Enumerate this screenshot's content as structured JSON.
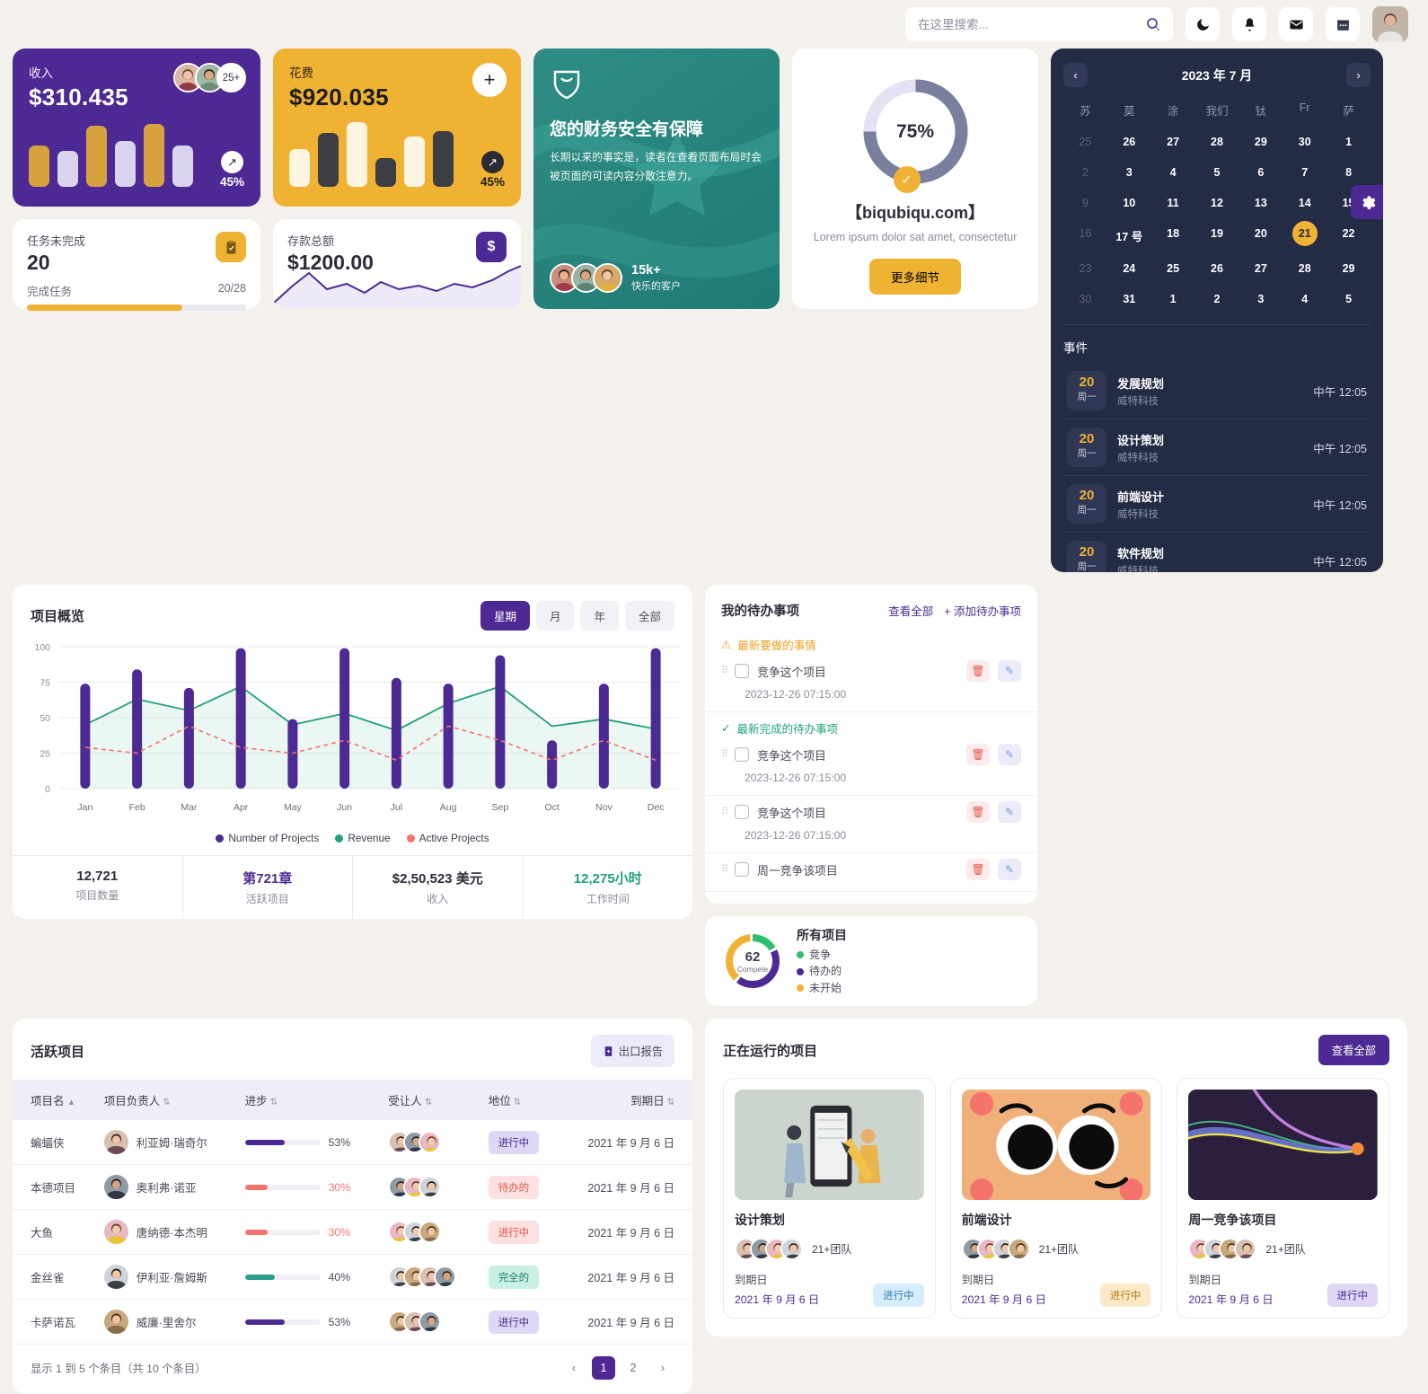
{
  "header": {
    "search_placeholder": "在这里搜索...",
    "icons": [
      "moon-icon",
      "bell-icon",
      "mail-icon",
      "calendar-icon"
    ]
  },
  "revenue_card": {
    "label": "收入",
    "value": "$310.435",
    "more_count": "25+",
    "trend_pct": "45%",
    "bars": [
      {
        "h": 46,
        "c": "#d8a33e"
      },
      {
        "h": 40,
        "c": "#d9d5ee"
      },
      {
        "h": 68,
        "c": "#d8a33e"
      },
      {
        "h": 51,
        "c": "#d9d5ee"
      },
      {
        "h": 70,
        "c": "#d8a33e"
      },
      {
        "h": 46,
        "c": "#d9d5ee"
      }
    ]
  },
  "expense_card": {
    "label": "花费",
    "value": "$920.035",
    "trend_pct": "45%",
    "bars": [
      {
        "h": 42,
        "c": "#fdf4e2"
      },
      {
        "h": 60,
        "c": "#3d3d44"
      },
      {
        "h": 72,
        "c": "#fdf4e2"
      },
      {
        "h": 32,
        "c": "#3d3d44"
      },
      {
        "h": 56,
        "c": "#fdf4e2"
      },
      {
        "h": 62,
        "c": "#3d3d44"
      }
    ]
  },
  "tasks_card": {
    "label": "任务未完成",
    "value": "20",
    "sub_label": "完成任务",
    "ratio": "20/28",
    "progress": 71
  },
  "deposit_card": {
    "label": "存款总额",
    "value": "$1200.00",
    "icon": "dollar-icon"
  },
  "promo_card": {
    "title": "您的财务安全有保障",
    "body": "长期以来的事实是，读者在查看页面布局时会被页面的可读内容分散注意力。",
    "customers_count": "15k+",
    "customers_label": "快乐的客户"
  },
  "donut_card": {
    "percent": "75%",
    "value": 75,
    "site": "【biqubiqu.com】",
    "subtitle": "Lorem ipsum dolor sat amet, consectetur",
    "button": "更多细节"
  },
  "calendar": {
    "month_title": "2023 年 7 月",
    "weekdays": [
      "苏",
      "莫",
      "涂",
      "我们",
      "钛",
      "Fr",
      "萨"
    ],
    "days": [
      {
        "d": "25",
        "mut": true
      },
      {
        "d": "26"
      },
      {
        "d": "27"
      },
      {
        "d": "28"
      },
      {
        "d": "29"
      },
      {
        "d": "30"
      },
      {
        "d": "1"
      },
      {
        "d": "2",
        "mut": true
      },
      {
        "d": "3"
      },
      {
        "d": "4"
      },
      {
        "d": "5"
      },
      {
        "d": "6"
      },
      {
        "d": "7"
      },
      {
        "d": "8"
      },
      {
        "d": "9",
        "mut": true
      },
      {
        "d": "10"
      },
      {
        "d": "11"
      },
      {
        "d": "12"
      },
      {
        "d": "13"
      },
      {
        "d": "14"
      },
      {
        "d": "15"
      },
      {
        "d": "16",
        "mut": true
      },
      {
        "d": "17 号"
      },
      {
        "d": "18"
      },
      {
        "d": "19"
      },
      {
        "d": "20"
      },
      {
        "d": "21",
        "sel": true
      },
      {
        "d": "22"
      },
      {
        "d": "23",
        "mut": true
      },
      {
        "d": "24"
      },
      {
        "d": "25"
      },
      {
        "d": "26"
      },
      {
        "d": "27"
      },
      {
        "d": "28"
      },
      {
        "d": "29"
      },
      {
        "d": "30",
        "mut": true
      },
      {
        "d": "31"
      },
      {
        "d": "1"
      },
      {
        "d": "2"
      },
      {
        "d": "3"
      },
      {
        "d": "4"
      },
      {
        "d": "5"
      }
    ],
    "events_title": "事件",
    "events": [
      {
        "day": "20",
        "weekday": "周一",
        "title": "发展规划",
        "company": "威特科技",
        "time": "中午 12:05"
      },
      {
        "day": "20",
        "weekday": "周一",
        "title": "设计策划",
        "company": "威特科技",
        "time": "中午 12:05"
      },
      {
        "day": "20",
        "weekday": "周一",
        "title": "前端设计",
        "company": "威特科技",
        "time": "中午 12:05"
      },
      {
        "day": "20",
        "weekday": "周一",
        "title": "软件规划",
        "company": "威特科技",
        "time": "中午 12:05"
      }
    ]
  },
  "overview": {
    "title": "项目概览",
    "filters": [
      {
        "label": "星期",
        "active": true
      },
      {
        "label": "月",
        "active": false
      },
      {
        "label": "年",
        "active": false
      },
      {
        "label": "全部",
        "active": false
      }
    ],
    "stats": [
      {
        "value": "12,721",
        "label": "项目数量",
        "color": "#2c2c3a"
      },
      {
        "value": "第721章",
        "label": "活跃项目",
        "color": "#4d2a93"
      },
      {
        "value": "$2,50,523 美元",
        "label": "收入",
        "color": "#2c2c3a"
      },
      {
        "value": "12,275小时",
        "label": "工作时间",
        "color": "#21a179"
      }
    ]
  },
  "chart_data": {
    "type": "bar",
    "title": "项目概览",
    "xlabel": "",
    "ylabel": "",
    "ylim": [
      0,
      100
    ],
    "yticks": [
      0,
      25,
      50,
      75,
      100
    ],
    "grid": true,
    "legend_position": "bottom",
    "categories": [
      "Jan",
      "Feb",
      "Mar",
      "Apr",
      "May",
      "Jun",
      "Jul",
      "Aug",
      "Sep",
      "Oct",
      "Nov",
      "Dec"
    ],
    "series": [
      {
        "name": "Number of Projects",
        "type": "bar",
        "color": "#4d2a93",
        "values": [
          74,
          84,
          71,
          99,
          49,
          99,
          78,
          74,
          94,
          34,
          74,
          99
        ]
      },
      {
        "name": "Revenue",
        "type": "area",
        "color": "#21a179",
        "values": [
          45,
          63,
          55,
          72,
          45,
          53,
          41,
          60,
          72,
          44,
          49,
          42
        ]
      },
      {
        "name": "Active Projects",
        "type": "line-dashed",
        "color": "#f4736d",
        "values": [
          29,
          25,
          44,
          29,
          25,
          34,
          20,
          44,
          34,
          20,
          34,
          20
        ]
      }
    ]
  },
  "todo": {
    "title": "我的待办事项",
    "see_all": "查看全部",
    "add": "+ 添加待办事项",
    "section_pending": "最新要做的事情",
    "section_done": "最新完成的待办事项",
    "items": [
      {
        "text": "竞争这个项目",
        "date": "2023-12-26 07:15:00",
        "section": "pending"
      },
      {
        "text": "竞争这个项目",
        "date": "2023-12-26 07:15:00",
        "section": "done"
      },
      {
        "text": "竞争这个项目",
        "date": "2023-12-26 07:15:00",
        "section": ""
      },
      {
        "text": "周一竞争该项目",
        "date": "",
        "section": ""
      }
    ]
  },
  "all_projects": {
    "center_value": "62",
    "center_label": "Compete",
    "title": "所有项目",
    "legend": [
      {
        "label": "竞争",
        "color": "#2fbf71"
      },
      {
        "label": "待办的",
        "color": "#4d2a93"
      },
      {
        "label": "未开始",
        "color": "#f0b232"
      }
    ],
    "segments": [
      {
        "label": "竞争",
        "value": 18,
        "color": "#2fbf71"
      },
      {
        "label": "待办的",
        "value": 44,
        "color": "#4d2a93"
      },
      {
        "label": "未开始",
        "value": 38,
        "color": "#f0b232"
      }
    ]
  },
  "table": {
    "title": "活跃项目",
    "export_label": "出口报告",
    "columns": [
      "项目名",
      "项目负责人",
      "进步",
      "受让人",
      "地位",
      "到期日"
    ],
    "rows": [
      {
        "name": "蝙蝠侠",
        "owner": "利亚姆·瑞奇尔",
        "progress": 53,
        "pct": "53%",
        "bar_color": "#4d2a93",
        "pct_color": "#4a4a58",
        "status": "进行中",
        "status_bg": "#ded7f5",
        "status_fg": "#4d2a93",
        "due": "2021 年 9 月 6 日",
        "team": 3
      },
      {
        "name": "本德项目",
        "owner": "奥利弗·诺亚",
        "progress": 30,
        "pct": "30%",
        "bar_color": "#f4736d",
        "pct_color": "#f4736d",
        "status": "待办的",
        "status_bg": "#fde0e0",
        "status_fg": "#e4564b",
        "due": "2021 年 9 月 6 日",
        "team": 3
      },
      {
        "name": "大鱼",
        "owner": "唐纳德·本杰明",
        "progress": 30,
        "pct": "30%",
        "bar_color": "#f4736d",
        "pct_color": "#f4736d",
        "status": "进行中",
        "status_bg": "#fde0e0",
        "status_fg": "#e4564b",
        "due": "2021 年 9 月 6 日",
        "team": 3
      },
      {
        "name": "金丝雀",
        "owner": "伊利亚·詹姆斯",
        "progress": 40,
        "pct": "40%",
        "bar_color": "#2a9d8f",
        "pct_color": "#4a4a58",
        "status": "完全的",
        "status_bg": "#c9f0e4",
        "status_fg": "#1d7f68",
        "due": "2021 年 9 月 6 日",
        "team": 4
      },
      {
        "name": "卡萨诺瓦",
        "owner": "威廉·里舍尔",
        "progress": 53,
        "pct": "53%",
        "bar_color": "#4d2a93",
        "pct_color": "#4a4a58",
        "status": "进行中",
        "status_bg": "#ded7f5",
        "status_fg": "#4d2a93",
        "due": "2021 年 9 月 6 日",
        "team": 3
      }
    ],
    "footer": "显示 1 到 5 个条目（共 10 个条目）",
    "pages": [
      "1",
      "2"
    ]
  },
  "running": {
    "title": "正在运行的项目",
    "see_all": "查看全部",
    "projects": [
      {
        "name": "设计策划",
        "team_label": "21+团队",
        "due_label": "到期日",
        "due": "2021 年 9 月 6 日",
        "status": "进行中",
        "status_bg": "#d6eefb",
        "status_fg": "#2f7fa8",
        "thumb": "design-illustration"
      },
      {
        "name": "前端设计",
        "team_label": "21+团队",
        "due_label": "到期日",
        "due": "2021 年 9 月 6 日",
        "status": "进行中",
        "status_bg": "#fce9c9",
        "status_fg": "#b87b12",
        "thumb": "face-illustration"
      },
      {
        "name": "周一竞争该项目",
        "team_label": "21+团队",
        "due_label": "到期日",
        "due": "2021 年 9 月 6 日",
        "status": "进行中",
        "status_bg": "#ded7f5",
        "status_fg": "#4d2a93",
        "thumb": "waves-illustration"
      }
    ]
  },
  "settings": {
    "gear": "gear-icon"
  }
}
